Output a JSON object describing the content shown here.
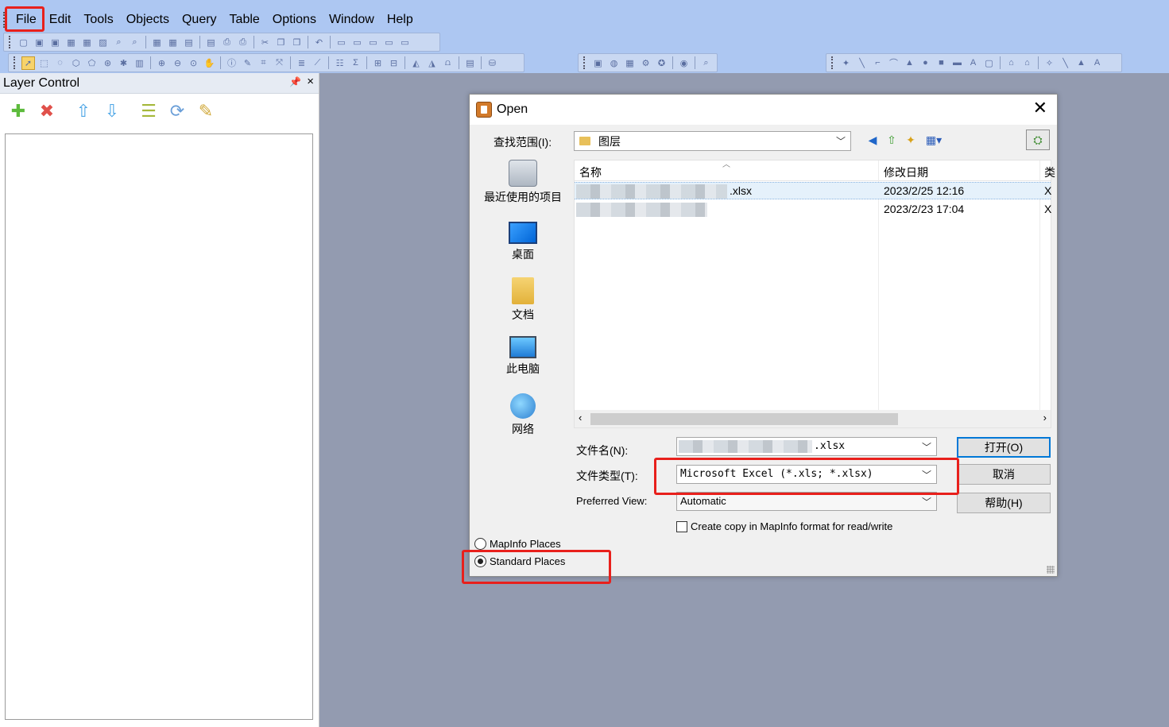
{
  "menubar": {
    "items": [
      "File",
      "Edit",
      "Tools",
      "Objects",
      "Query",
      "Table",
      "Options",
      "Window",
      "Help"
    ]
  },
  "layer_control": {
    "title": "Layer Control",
    "pin_icon": "pin-icon",
    "close_glyph": "×",
    "tools": [
      "add-layer-icon",
      "remove-layer-icon",
      "move-up-icon",
      "move-down-icon",
      "layer-properties-icon",
      "reorder-icon",
      "label-icon"
    ]
  },
  "dialog": {
    "title": "Open",
    "close_glyph": "✕",
    "lookin_label": "查找范围(I):",
    "lookin_value": "图层",
    "places": [
      {
        "label": "最近使用的项目"
      },
      {
        "label": "桌面"
      },
      {
        "label": "文档"
      },
      {
        "label": "此电脑"
      },
      {
        "label": "网络"
      }
    ],
    "columns": {
      "name": "名称",
      "date": "修改日期",
      "type": "类"
    },
    "files": [
      {
        "name": ".xlsx",
        "date": "2023/2/25 12:16",
        "type": "X",
        "selected": true
      },
      {
        "name": "",
        "date": "2023/2/23 17:04",
        "type": "X",
        "selected": false
      }
    ],
    "filename_label": "文件名(N):",
    "filename_value": ".xlsx",
    "filetype_label": "文件类型(T):",
    "filetype_value": "Microsoft Excel (*.xls; *.xlsx)",
    "preferred_label": "Preferred View:",
    "preferred_value": "Automatic",
    "open_button": "打开(O)",
    "cancel_button": "取消",
    "help_button": "帮助(H)",
    "create_copy_label": "Create copy in MapInfo format for read/write",
    "radio_mapinfo": "MapInfo Places",
    "radio_standard": "Standard Places",
    "radio_selected": "Standard Places"
  },
  "colors": {
    "menubar_bg": "#adc7f2",
    "annotation_red": "#e8201c",
    "workspace_bg": "#939bb0"
  }
}
